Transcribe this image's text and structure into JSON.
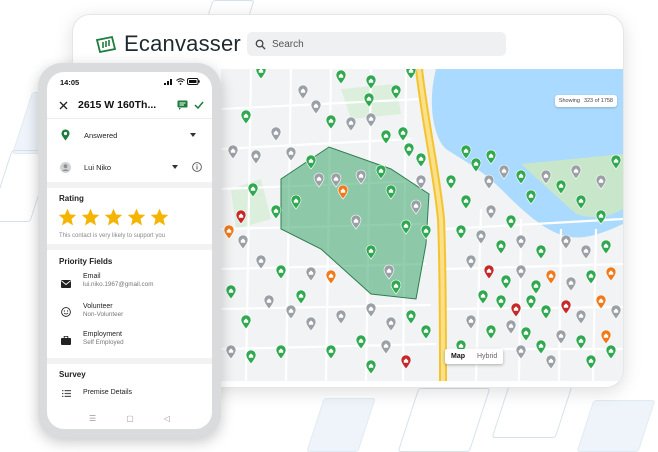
{
  "desktop": {
    "app_name": "Ecanvasser",
    "search_placeholder": "Search",
    "map": {
      "zoom_label": "Showing",
      "zoom_value": "323 of 1758",
      "type_buttons": [
        "Map",
        "Hybrid"
      ],
      "active_type": "Map"
    }
  },
  "phone": {
    "status_time": "14:05",
    "title": "2615 W 160Th...",
    "status_field": "Answered",
    "assignee_field": "Lui Niko",
    "rating": {
      "heading": "Rating",
      "stars": 5,
      "max_stars": 5,
      "caption": "This contact is very likely to support you"
    },
    "priority": {
      "heading": "Priority Fields",
      "fields": [
        {
          "label": "Email",
          "value": "lui.niko.1967@gmail.com",
          "icon": "mail-icon"
        },
        {
          "label": "Volunteer",
          "value": "Non-Volunteer",
          "icon": "smiley-icon"
        },
        {
          "label": "Employment",
          "value": "Self Employed",
          "icon": "briefcase-icon"
        }
      ]
    },
    "survey": {
      "heading": "Survey",
      "item": "Premise Details"
    },
    "nav": [
      "☰",
      "▢",
      "◁"
    ]
  },
  "colors": {
    "brand_green": "#1e7c3c",
    "pin_green": "#2fa84f",
    "pin_gray": "#9aa0a6",
    "pin_orange": "#f07a1a",
    "pin_red": "#c62828",
    "star": "#f5b400",
    "polygon_fill": "#3aa56c"
  }
}
